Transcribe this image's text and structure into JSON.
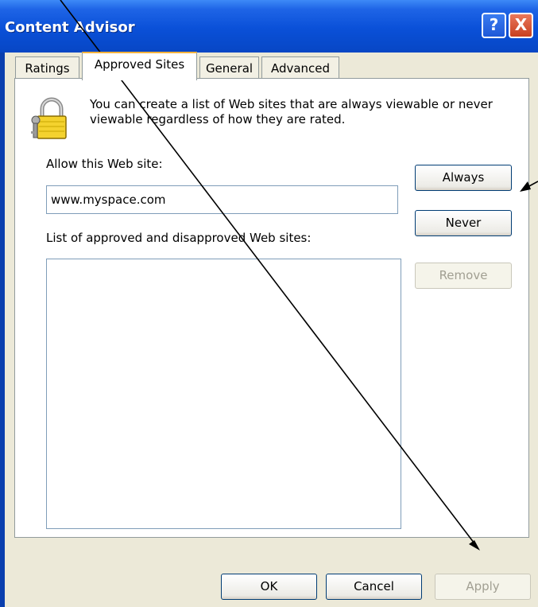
{
  "window": {
    "title": "Content Advisor",
    "help_label": "?",
    "close_label": "X"
  },
  "tabs": [
    {
      "label": "Ratings",
      "active": false
    },
    {
      "label": "Approved Sites",
      "active": true
    },
    {
      "label": "General",
      "active": false
    },
    {
      "label": "Advanced",
      "active": false
    }
  ],
  "panel": {
    "description": "You can create a list of Web sites that are always viewable or never viewable regardless of how they are rated.",
    "allow_label": "Allow this Web site:",
    "allow_value": "www.myspace.com",
    "list_label": "List of approved and disapproved Web sites:",
    "always_label": "Always",
    "never_label": "Never",
    "remove_label": "Remove"
  },
  "footer": {
    "ok_label": "OK",
    "cancel_label": "Cancel",
    "apply_label": "Apply"
  },
  "colors": {
    "titlebar": "#0A50D8",
    "dialog_bg": "#ECE9D8",
    "button_border": "#003C74",
    "disabled_text": "#A19F92"
  }
}
